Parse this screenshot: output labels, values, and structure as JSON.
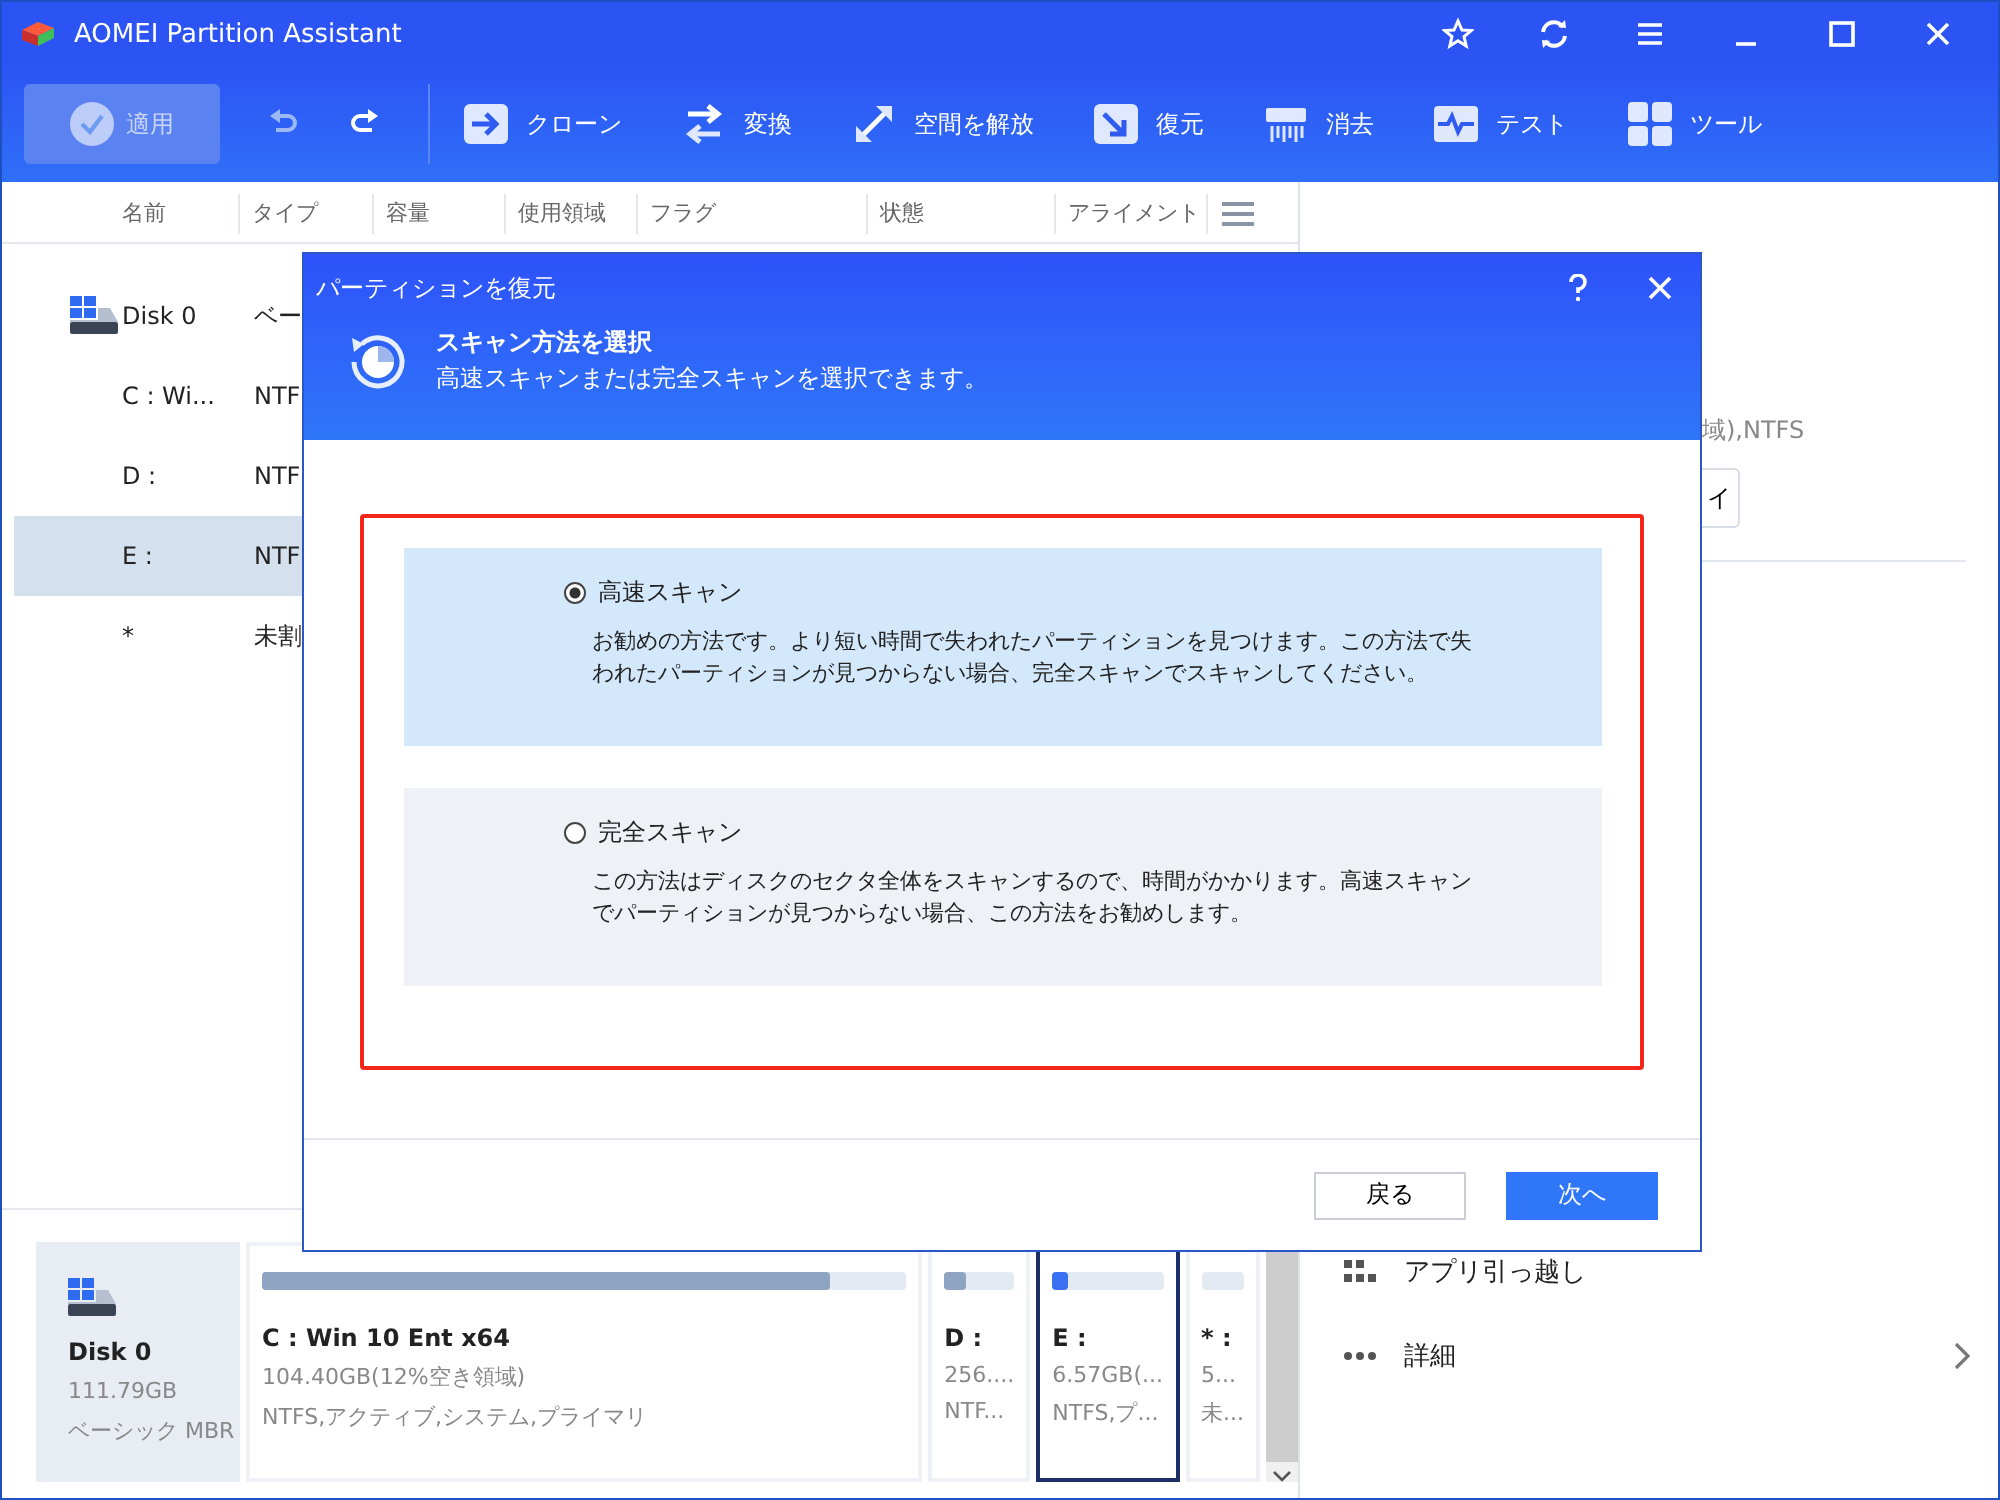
{
  "window": {
    "title": "AOMEI Partition Assistant"
  },
  "toolbar": {
    "apply": {
      "label": "適用",
      "disabled": true
    },
    "items": [
      {
        "label": "クローン",
        "kind": "clone"
      },
      {
        "label": "変換",
        "kind": "convert"
      },
      {
        "label": "空間を解放",
        "kind": "free"
      },
      {
        "label": "復元",
        "kind": "recover"
      },
      {
        "label": "消去",
        "kind": "wipe"
      },
      {
        "label": "テスト",
        "kind": "test"
      },
      {
        "label": "ツール",
        "kind": "tools"
      }
    ]
  },
  "table": {
    "columns": [
      "名前",
      "タイプ",
      "容量",
      "使用領域",
      "フラグ",
      "状態",
      "アライメント"
    ],
    "rows": [
      {
        "kind": "disk",
        "name": "Disk 0",
        "type": "ベー",
        "selected": false
      },
      {
        "kind": "partition",
        "name": "C : Wi...",
        "type": "NTF",
        "selected": false
      },
      {
        "kind": "partition",
        "name": "D :",
        "type": "NTF",
        "selected": false
      },
      {
        "kind": "partition",
        "name": "E :",
        "type": "NTF",
        "selected": true
      },
      {
        "kind": "partition",
        "name": "*",
        "type": "未割",
        "selected": false
      }
    ]
  },
  "right_panel": {
    "info": "域),NTFS",
    "button": "イ",
    "actions": [
      {
        "kind": "apps",
        "label": "アプリ引っ越し"
      },
      {
        "kind": "more",
        "label": "詳細"
      }
    ]
  },
  "disk_map": {
    "disk": {
      "name": "Disk 0",
      "size": "111.79GB",
      "type": "ベーシック MBR"
    },
    "partitions": [
      {
        "label": "C : Win 10 Ent x64",
        "size": "104.40GB(12%空き領域)",
        "info": "NTFS,アクティブ,システム,プライマリ",
        "level": 0.88,
        "selected": false
      },
      {
        "label": "D :",
        "size": "256....",
        "info": "NTF...",
        "level": 0.3,
        "selected": false
      },
      {
        "label": "E :",
        "size": "6.57GB(...",
        "info": "NTFS,プ...",
        "level": 0.15,
        "selected": true
      },
      {
        "label": "* :",
        "size": "5...",
        "info": "未...",
        "level": 0,
        "selected": false
      }
    ]
  },
  "dialog": {
    "title": "パーティションを復元",
    "heading": "スキャン方法を選択",
    "subheading": "高速スキャンまたは完全スキャンを選択できます。",
    "options": [
      {
        "title": "高速スキャン",
        "description": "お勧めの方法です。より短い時間で失われたパーティションを見つけます。この方法で失われたパーティションが見つからない場合、完全スキャンでスキャンしてください。",
        "selected": true
      },
      {
        "title": "完全スキャン",
        "description": "この方法はディスクのセクタ全体をスキャンするので、時間がかかります。高速スキャンでパーティションが見つからない場合、この方法をお勧めします。",
        "selected": false
      }
    ],
    "buttons": {
      "back": "戻る",
      "next": "次へ"
    }
  }
}
